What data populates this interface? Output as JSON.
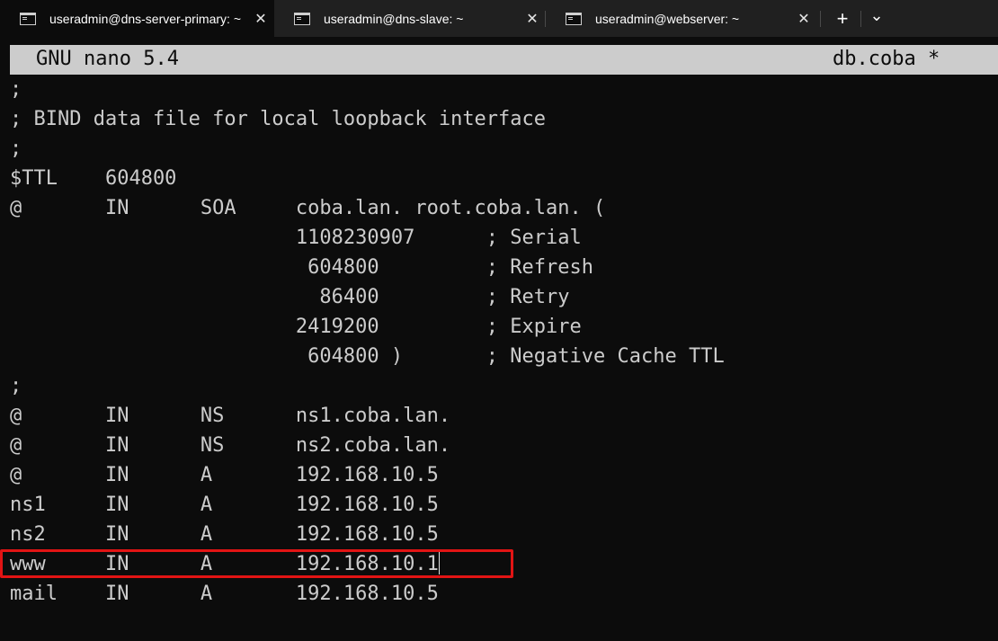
{
  "tabs": [
    {
      "title": "useradmin@dns-server-primary: ~",
      "active": true
    },
    {
      "title": "useradmin@dns-slave: ~",
      "active": false
    },
    {
      "title": "useradmin@webserver: ~",
      "active": false
    }
  ],
  "tabbar": {
    "close_glyph": "✕",
    "new_tab_glyph": "+",
    "dropdown_glyph": "⌄"
  },
  "nano": {
    "version_label": "GNU nano 5.4",
    "filename": "db.coba *"
  },
  "file_lines": [
    ";",
    "; BIND data file for local loopback interface",
    ";",
    "$TTL    604800",
    "@       IN      SOA     coba.lan. root.coba.lan. (",
    "                        1108230907      ; Serial",
    "                         604800         ; Refresh",
    "                          86400         ; Retry",
    "                        2419200         ; Expire",
    "                         604800 )       ; Negative Cache TTL",
    ";",
    "@       IN      NS      ns1.coba.lan.",
    "@       IN      NS      ns2.coba.lan.",
    "@       IN      A       192.168.10.5",
    "ns1     IN      A       192.168.10.5",
    "ns2     IN      A       192.168.10.5",
    "www     IN      A       192.168.10.1",
    "mail    IN      A       192.168.10.5"
  ],
  "colors": {
    "terminal_bg": "#0c0c0c",
    "terminal_fg": "#cccccc",
    "tabbar_bg": "#202020",
    "nano_header_bg": "#cccccc",
    "highlight_border": "#e21414"
  }
}
